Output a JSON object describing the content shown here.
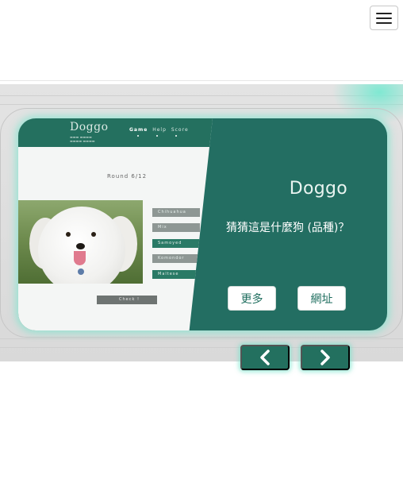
{
  "navbar": {
    "menu_icon": "hamburger-icon"
  },
  "slide": {
    "title": "Doggo",
    "question": "猜猜這是什麼狗 (品種)？",
    "buttons": {
      "more": "更多",
      "site": "網址"
    },
    "thumbnail": {
      "logo": "Doggo",
      "nav": [
        "Game",
        "Help",
        "Score"
      ],
      "round": "Round 6/12",
      "options": [
        "Chihuahua",
        "Mix",
        "Samoyed",
        "Komondor",
        "Maltese"
      ],
      "check": "Check !"
    }
  },
  "carousel": {
    "prev_icon": "chevron-left-icon",
    "next_icon": "chevron-right-icon"
  },
  "colors": {
    "brand": "#236e62",
    "glow": "#7fe8d2"
  }
}
